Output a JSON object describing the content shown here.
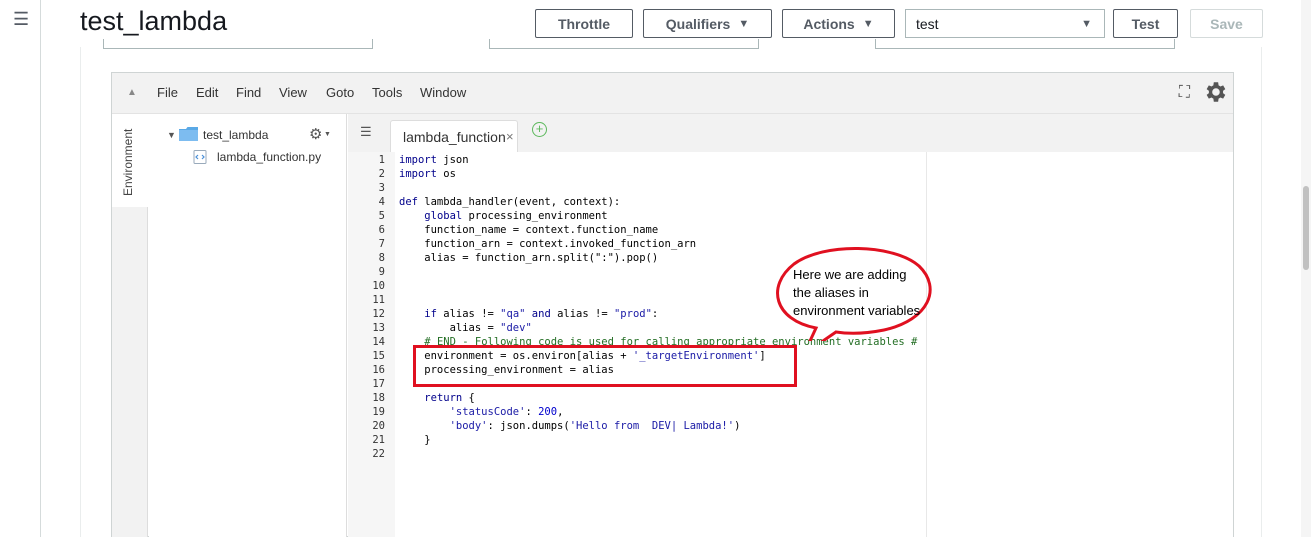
{
  "header": {
    "title": "test_lambda",
    "throttle_label": "Throttle",
    "qualifiers_label": "Qualifiers",
    "actions_label": "Actions",
    "test_event_selected": "test",
    "test_label": "Test",
    "save_label": "Save"
  },
  "ide": {
    "menu": [
      "File",
      "Edit",
      "Find",
      "View",
      "Goto",
      "Tools",
      "Window"
    ],
    "env_tab_label": "Environment",
    "tree": {
      "root_folder": "test_lambda",
      "file": "lambda_function.py"
    },
    "editor_tab": "lambda_function",
    "active_line": 20,
    "code_lines": [
      [
        {
          "t": "import",
          "c": "kw"
        },
        {
          "t": " json"
        }
      ],
      [
        {
          "t": "import",
          "c": "kw"
        },
        {
          "t": " os"
        }
      ],
      [],
      [
        {
          "t": "def",
          "c": "kw"
        },
        {
          "t": " lambda_handler(event, context):"
        }
      ],
      [
        {
          "t": "    "
        },
        {
          "t": "global",
          "c": "kw"
        },
        {
          "t": " processing_environment"
        }
      ],
      [
        {
          "t": "    function_name = context.function_name"
        }
      ],
      [
        {
          "t": "    function_arn = context.invoked_function_arn"
        }
      ],
      [
        {
          "t": "    alias = function_arn.split(\":\").pop()"
        }
      ],
      [],
      [],
      [],
      [
        {
          "t": "    "
        },
        {
          "t": "if",
          "c": "kw"
        },
        {
          "t": " alias != "
        },
        {
          "t": "\"qa\"",
          "c": "str"
        },
        {
          "t": " "
        },
        {
          "t": "and",
          "c": "kw"
        },
        {
          "t": " alias != "
        },
        {
          "t": "\"prod\"",
          "c": "str"
        },
        {
          "t": ":"
        }
      ],
      [
        {
          "t": "        alias = "
        },
        {
          "t": "\"dev\"",
          "c": "str"
        }
      ],
      [
        {
          "t": "    "
        },
        {
          "t": "# END - Following code is used for calling appropriate environment variables #",
          "c": "comment"
        }
      ],
      [
        {
          "t": "    environment = os.environ[alias + "
        },
        {
          "t": "'_targetEnvironment'",
          "c": "str"
        },
        {
          "t": "]"
        }
      ],
      [
        {
          "t": "    processing_environment = alias"
        }
      ],
      [],
      [
        {
          "t": "    "
        },
        {
          "t": "return",
          "c": "kw"
        },
        {
          "t": " {"
        }
      ],
      [
        {
          "t": "        "
        },
        {
          "t": "'statusCode'",
          "c": "str"
        },
        {
          "t": ": "
        },
        {
          "t": "200",
          "c": "num"
        },
        {
          "t": ","
        }
      ],
      [
        {
          "t": "        "
        },
        {
          "t": "'body'",
          "c": "str"
        },
        {
          "t": ": json.dumps("
        },
        {
          "t": "'Hello from  DEV| Lambda!'",
          "c": "str"
        },
        {
          "t": ")"
        }
      ],
      [
        {
          "t": "    }"
        }
      ],
      []
    ]
  },
  "annotation": {
    "callout_text": "Here we are adding the aliases in environment variables",
    "color": "#e01020"
  },
  "icons": {
    "menu": "hamburger-icon",
    "settings": "gear-icon",
    "fullscreen": "fullscreen-icon",
    "folder": "folder-icon",
    "python_file": "python-file-icon",
    "add_tab": "plus-circle-icon"
  }
}
